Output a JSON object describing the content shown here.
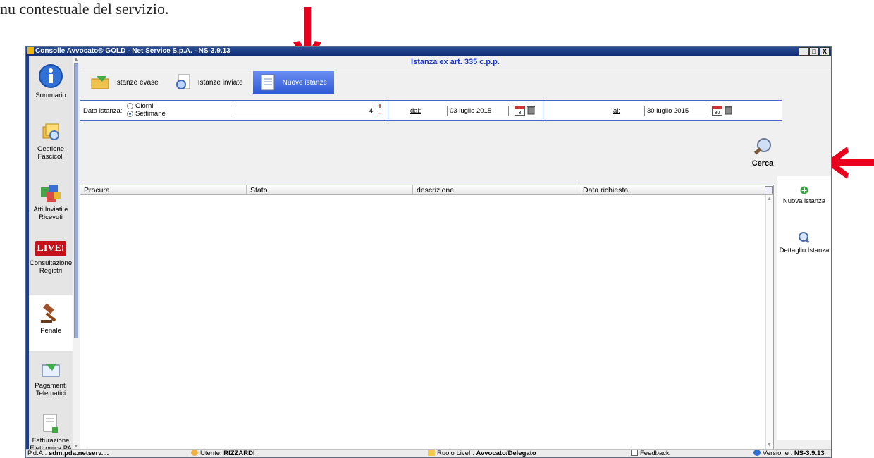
{
  "document": {
    "text": "nu contestuale del servizio."
  },
  "window": {
    "title": "Consolle Avvocato® GOLD - Net Service S.p.A. - NS-3.9.13",
    "controls": [
      "_",
      "□",
      "X"
    ]
  },
  "sidebar": {
    "items": [
      {
        "label": "Sommario",
        "icon": "info-icon"
      },
      {
        "label": "Gestione Fascicoli",
        "icon": "folders-icon"
      },
      {
        "label": "Atti Inviati e Ricevuti",
        "icon": "documents-icon"
      },
      {
        "label": "Consultazione Registri",
        "icon": "live-icon",
        "badge": "LIVE!"
      },
      {
        "label": "Penale",
        "icon": "gavel-icon",
        "active": true
      },
      {
        "label": "Pagamenti Telematici",
        "icon": "payment-icon"
      },
      {
        "label": "Fatturazione Elettronica PA",
        "icon": "invoice-icon"
      }
    ]
  },
  "header": {
    "title": "Istanza ex art. 335 c.p.p."
  },
  "tabs": [
    {
      "label": "Istanze evase",
      "active": false
    },
    {
      "label": "Istanze inviate",
      "active": false
    },
    {
      "label": "Nuove istanze",
      "active": true
    }
  ],
  "filter": {
    "data_istanza_label": "Data istanza:",
    "radio_giorni": "Giorni",
    "radio_settimane": "Settimane",
    "selected": "Settimane",
    "count_value": "4",
    "dal_label": "dal:",
    "dal_value": "03 luglio 2015",
    "dal_cal_day": "3",
    "al_label": "al:",
    "al_value": "30 luglio 2015",
    "al_cal_day": "30"
  },
  "search": {
    "label": "Cerca"
  },
  "table": {
    "columns": [
      "Procura",
      "Stato",
      "descrizione",
      "Data richiesta"
    ],
    "rows": []
  },
  "actions": [
    {
      "label": "Nuova istanza",
      "icon": "add-icon"
    },
    {
      "label": "Dettaglio Istanza",
      "icon": "magnifier-icon"
    }
  ],
  "statusbar": {
    "pda_label": "P.d.A.:",
    "pda_value": "sdm.pda.netserv....",
    "user_label": "Utente:",
    "user_value": "RIZZARDI",
    "role_label": "Ruolo Live! :",
    "role_value": "Avvocato/Delegato",
    "feedback_label": "Feedback",
    "version_label": "Versione :",
    "version_value": "NS-3.9.13"
  },
  "colors": {
    "annotation_arrow": "#e8001c",
    "title_text": "#1736c9",
    "active_tab": "#2f5ad8"
  }
}
